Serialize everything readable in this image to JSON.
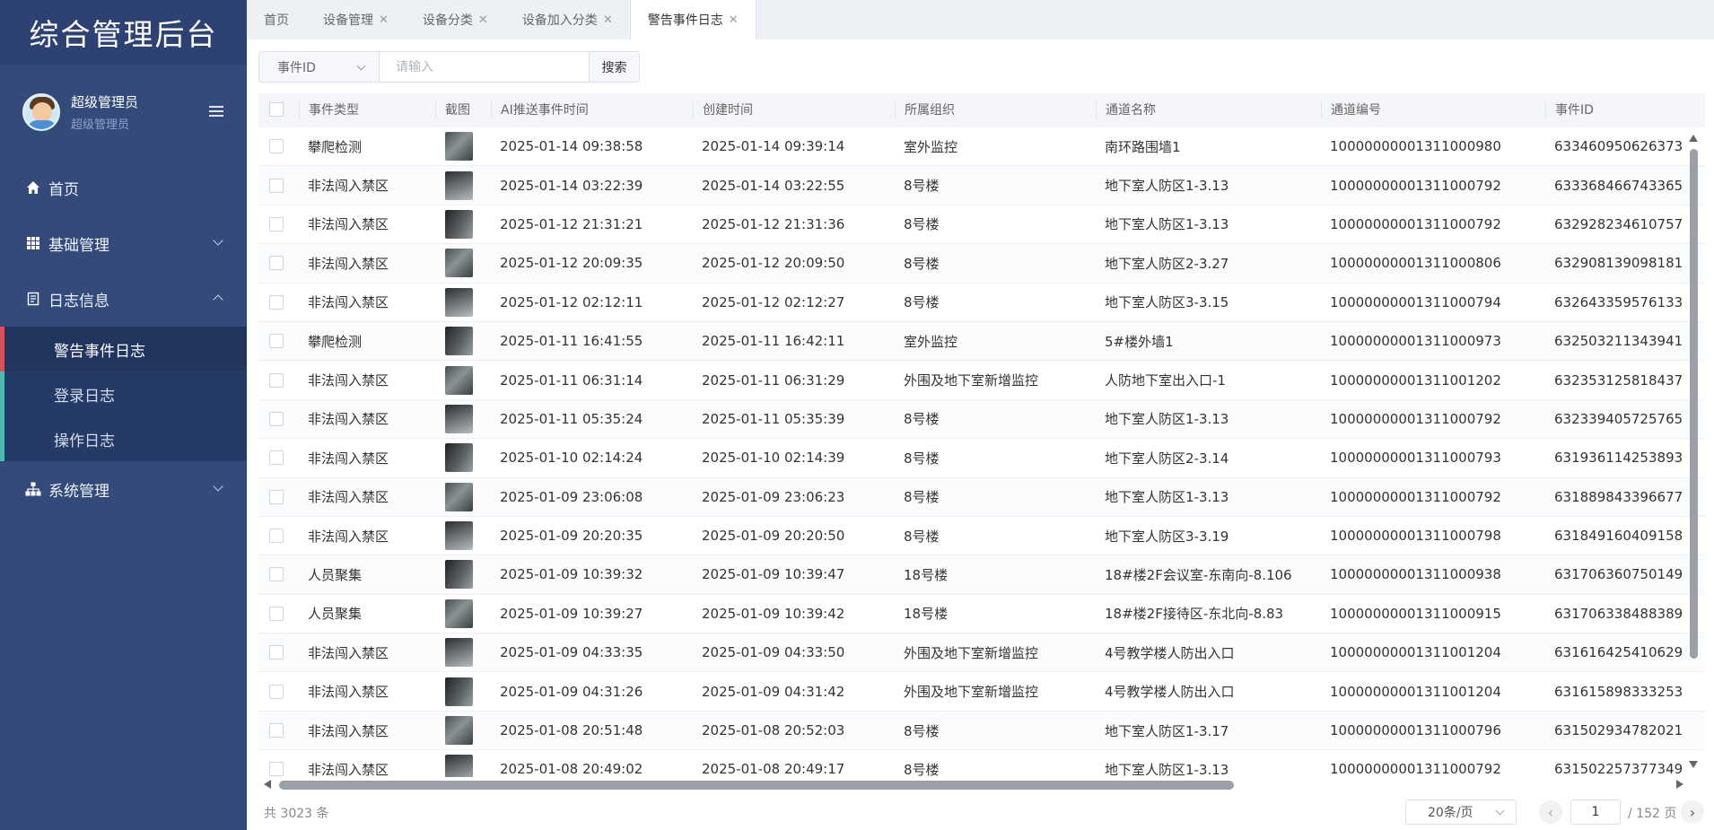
{
  "sidebar": {
    "logo": "综合管理后台",
    "user": {
      "name": "超级管理员",
      "role": "超级管理员"
    },
    "nav": [
      {
        "label": "首页",
        "icon": "home-icon"
      },
      {
        "label": "基础管理",
        "icon": "grid-icon"
      },
      {
        "label": "日志信息",
        "icon": "document-icon"
      }
    ],
    "submenu": [
      {
        "label": "警告事件日志"
      },
      {
        "label": "登录日志"
      },
      {
        "label": "操作日志"
      }
    ],
    "system": {
      "label": "系统管理",
      "icon": "sitemap-icon"
    }
  },
  "tabs": [
    {
      "label": "首页"
    },
    {
      "label": "设备管理"
    },
    {
      "label": "设备分类"
    },
    {
      "label": "设备加入分类"
    },
    {
      "label": "警告事件日志"
    }
  ],
  "search": {
    "field": "事件ID",
    "placeholder": "请输入",
    "button": "搜索"
  },
  "table": {
    "columns": [
      "事件类型",
      "截图",
      "AI推送事件时间",
      "创建时间",
      "所属组织",
      "通道名称",
      "通道编号",
      "事件ID"
    ],
    "rows": [
      [
        "攀爬检测",
        "2025-01-14 09:38:58",
        "2025-01-14 09:39:14",
        "室外监控",
        "南环路围墙1",
        "10000000001311000980",
        "633460950626373"
      ],
      [
        "非法闯入禁区",
        "2025-01-14 03:22:39",
        "2025-01-14 03:22:55",
        "8号楼",
        "地下室人防区1-3.13",
        "10000000001311000792",
        "633368466743365"
      ],
      [
        "非法闯入禁区",
        "2025-01-12 21:31:21",
        "2025-01-12 21:31:36",
        "8号楼",
        "地下室人防区1-3.13",
        "10000000001311000792",
        "632928234610757"
      ],
      [
        "非法闯入禁区",
        "2025-01-12 20:09:35",
        "2025-01-12 20:09:50",
        "8号楼",
        "地下室人防区2-3.27",
        "10000000001311000806",
        "632908139098181"
      ],
      [
        "非法闯入禁区",
        "2025-01-12 02:12:11",
        "2025-01-12 02:12:27",
        "8号楼",
        "地下室人防区3-3.15",
        "10000000001311000794",
        "632643359576133"
      ],
      [
        "攀爬检测",
        "2025-01-11 16:41:55",
        "2025-01-11 16:42:11",
        "室外监控",
        "5#楼外墙1",
        "10000000001311000973",
        "632503211343941"
      ],
      [
        "非法闯入禁区",
        "2025-01-11 06:31:14",
        "2025-01-11 06:31:29",
        "外围及地下室新增监控",
        "人防地下室出入口-1",
        "10000000001311001202",
        "632353125818437"
      ],
      [
        "非法闯入禁区",
        "2025-01-11 05:35:24",
        "2025-01-11 05:35:39",
        "8号楼",
        "地下室人防区1-3.13",
        "10000000001311000792",
        "632339405725765"
      ],
      [
        "非法闯入禁区",
        "2025-01-10 02:14:24",
        "2025-01-10 02:14:39",
        "8号楼",
        "地下室人防区2-3.14",
        "10000000001311000793",
        "631936114253893"
      ],
      [
        "非法闯入禁区",
        "2025-01-09 23:06:08",
        "2025-01-09 23:06:23",
        "8号楼",
        "地下室人防区1-3.13",
        "10000000001311000792",
        "631889843396677"
      ],
      [
        "非法闯入禁区",
        "2025-01-09 20:20:35",
        "2025-01-09 20:20:50",
        "8号楼",
        "地下室人防区3-3.19",
        "10000000001311000798",
        "631849160409158"
      ],
      [
        "人员聚集",
        "2025-01-09 10:39:32",
        "2025-01-09 10:39:47",
        "18号楼",
        "18#楼2F会议室-东南向-8.106",
        "10000000001311000938",
        "631706360750149"
      ],
      [
        "人员聚集",
        "2025-01-09 10:39:27",
        "2025-01-09 10:39:42",
        "18号楼",
        "18#楼2F接待区-东北向-8.83",
        "10000000001311000915",
        "631706338488389"
      ],
      [
        "非法闯入禁区",
        "2025-01-09 04:33:35",
        "2025-01-09 04:33:50",
        "外围及地下室新增监控",
        "4号教学楼人防出入口",
        "10000000001311001204",
        "631616425410629"
      ],
      [
        "非法闯入禁区",
        "2025-01-09 04:31:26",
        "2025-01-09 04:31:42",
        "外围及地下室新增监控",
        "4号教学楼人防出入口",
        "10000000001311001204",
        "631615898333253"
      ],
      [
        "非法闯入禁区",
        "2025-01-08 20:51:48",
        "2025-01-08 20:52:03",
        "8号楼",
        "地下室人防区1-3.17",
        "10000000001311000796",
        "631502934782021"
      ],
      [
        "非法闯入禁区",
        "2025-01-08 20:49:02",
        "2025-01-08 20:49:17",
        "8号楼",
        "地下室人防区1-3.13",
        "10000000001311000792",
        "631502257377349"
      ]
    ]
  },
  "footer": {
    "total": "共 3023 条",
    "page_size": "20条/页",
    "current_page": "1",
    "total_pages": "/ 152 页"
  }
}
